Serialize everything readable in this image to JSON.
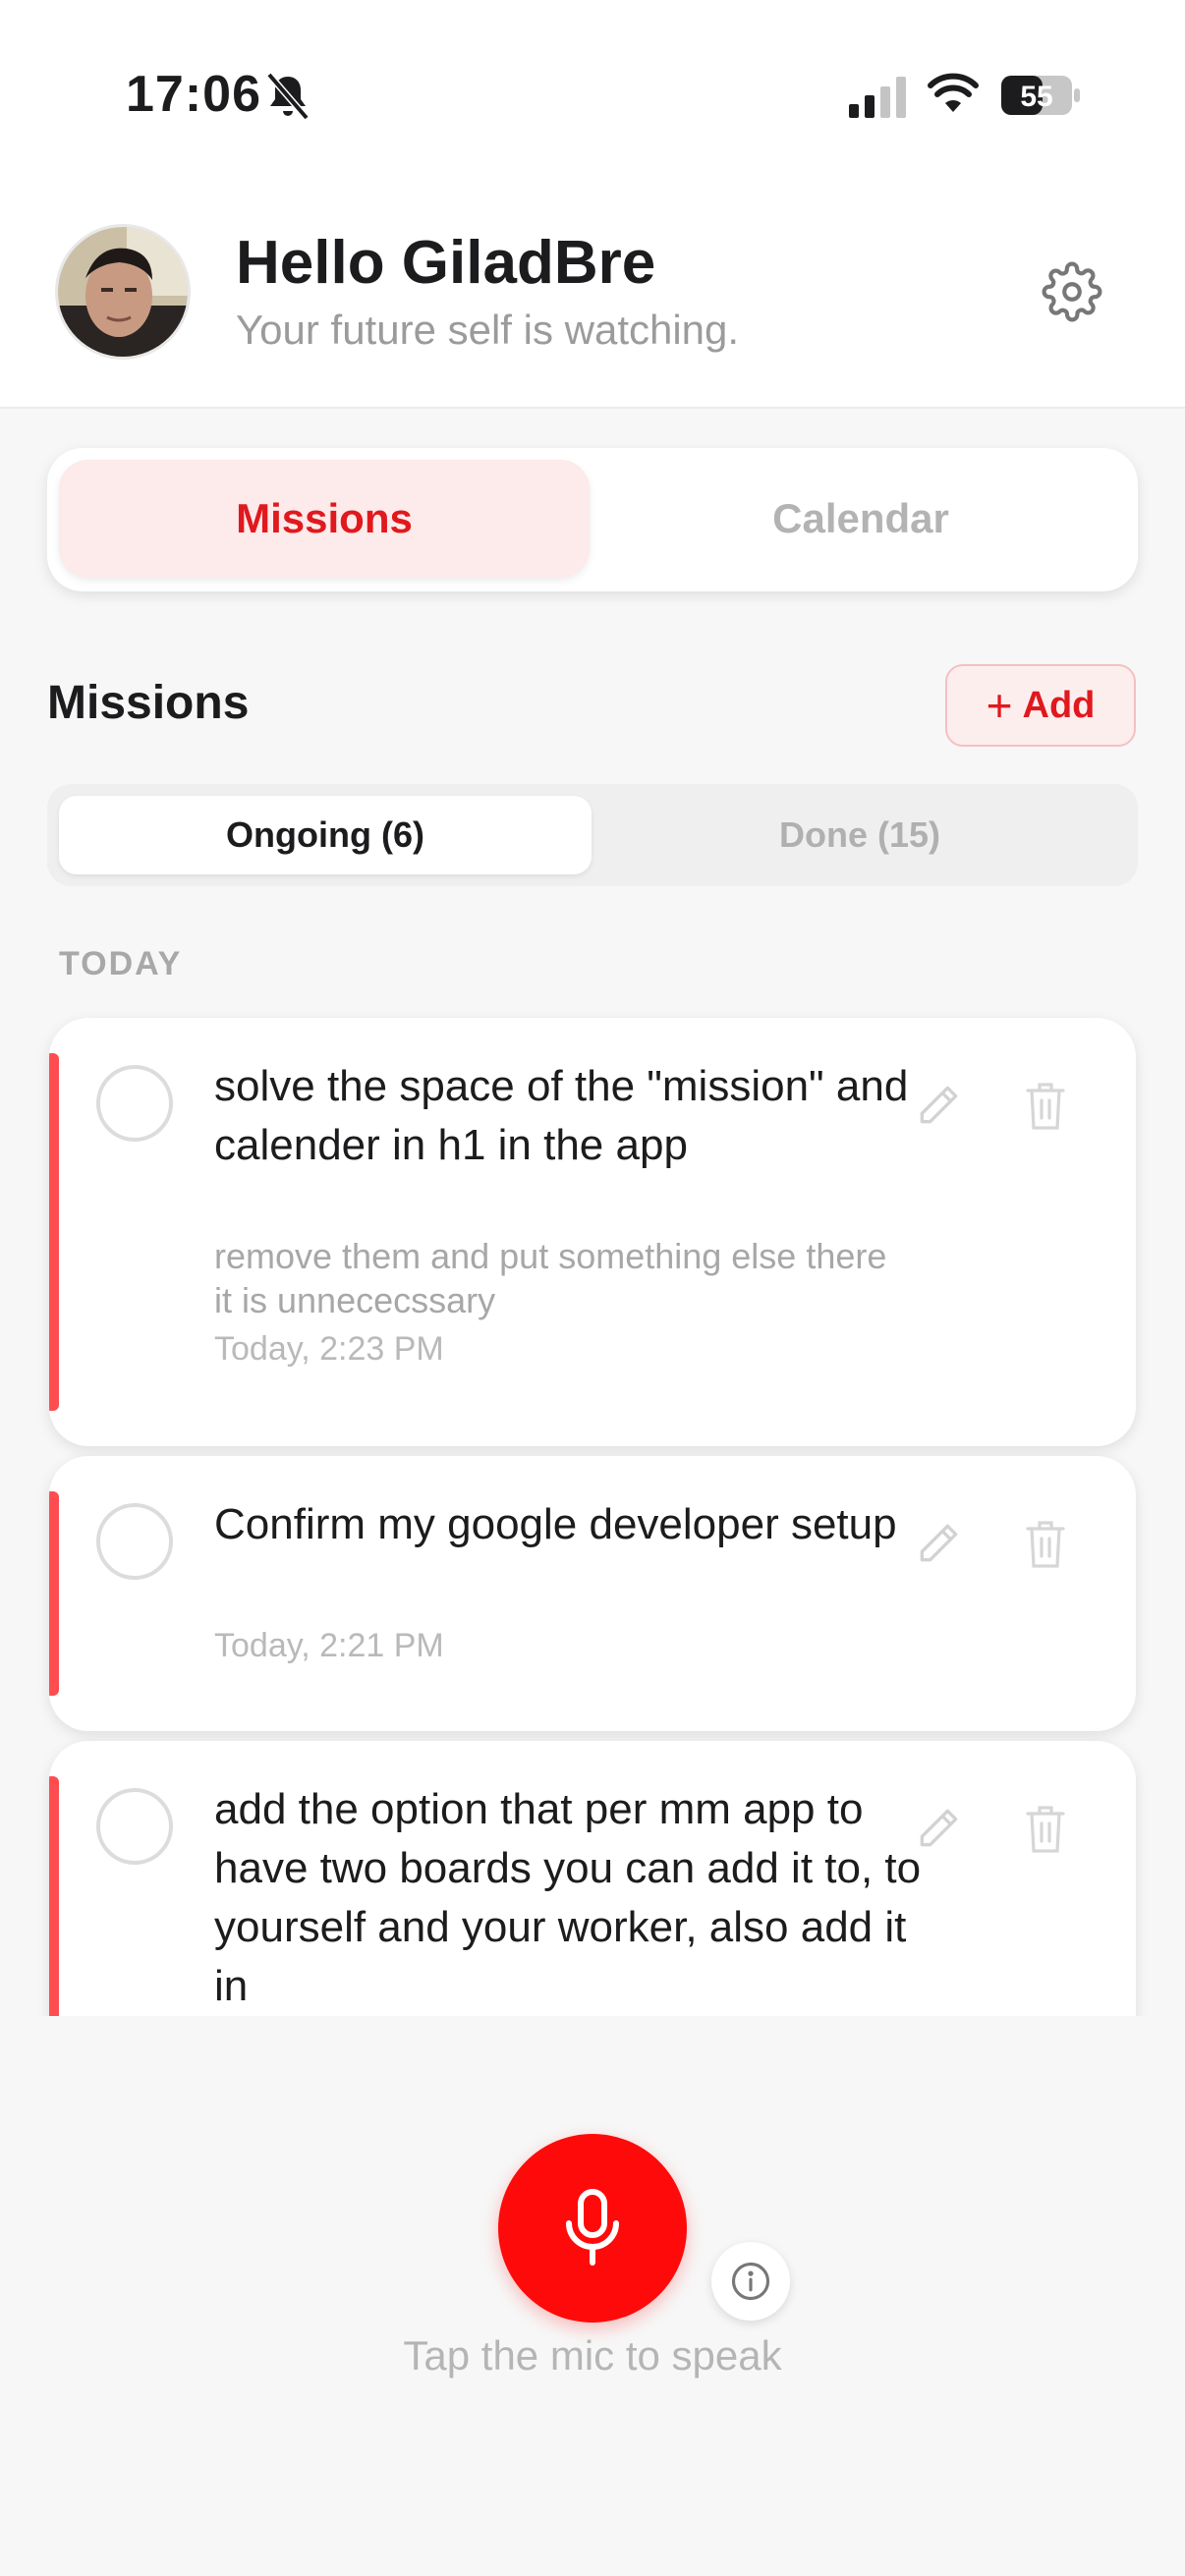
{
  "status_bar": {
    "time": "17:06",
    "battery": "55"
  },
  "header": {
    "greeting": "Hello GiladBre",
    "tagline": "Your future self is watching."
  },
  "top_tabs": [
    {
      "label": "Missions",
      "active": true
    },
    {
      "label": "Calendar",
      "active": false
    }
  ],
  "section": {
    "title": "Missions",
    "add_label": "Add"
  },
  "filters": [
    {
      "label": "Ongoing (6)",
      "active": true
    },
    {
      "label": "Done (15)",
      "active": false
    }
  ],
  "day_label": "TODAY",
  "missions": [
    {
      "title": "solve the space of the \"mission\" and calender in h1 in the app",
      "description": "remove them and put something else there it is unnececssary",
      "time": "Today, 2:23 PM"
    },
    {
      "title": "Confirm my google developer setup",
      "description": "",
      "time": "Today, 2:21 PM"
    },
    {
      "title": "add the option that per mm app to have two boards you can add it to, to yourself and your worker, also add it in",
      "description": "",
      "time": ""
    }
  ],
  "mic": {
    "hint": "Tap the mic to speak"
  },
  "colors": {
    "accent": "#e0191e",
    "mic": "#ff0a0a",
    "priority_bar": "#ff4d4f"
  }
}
